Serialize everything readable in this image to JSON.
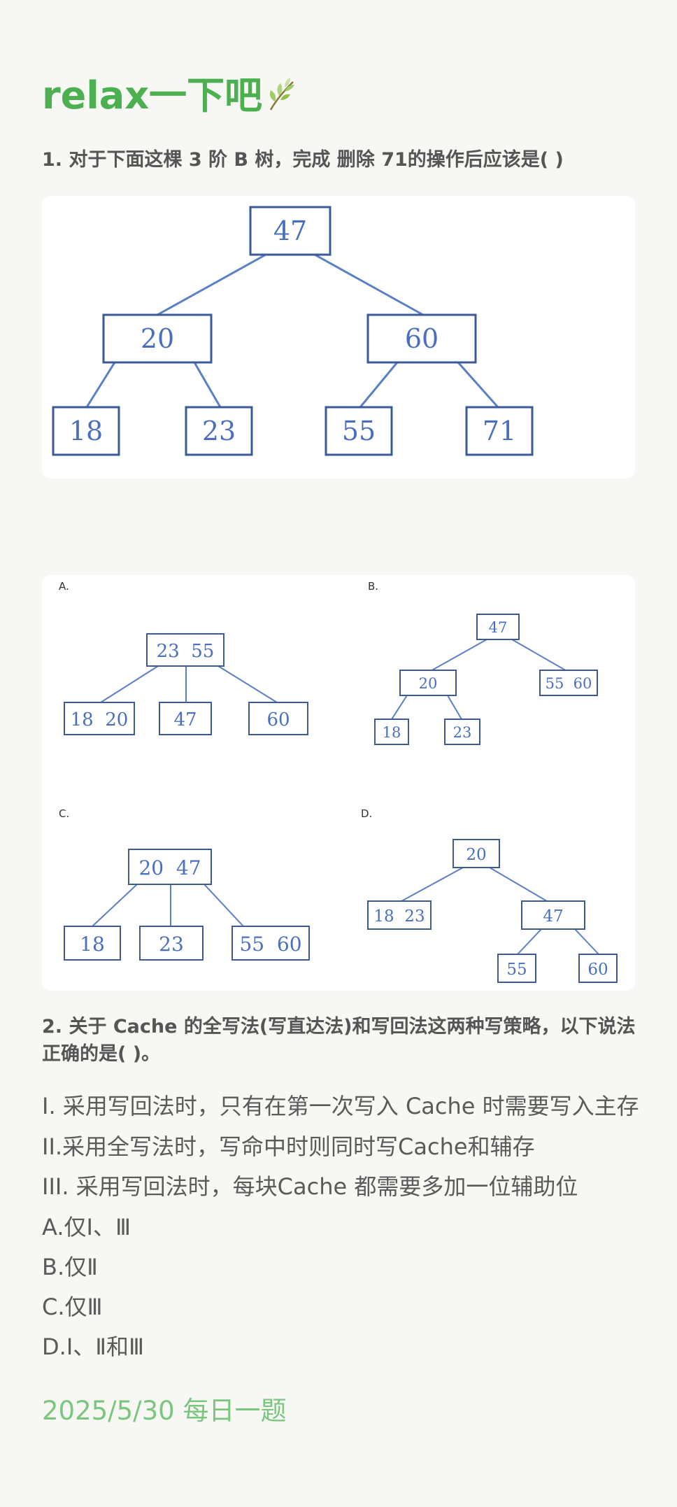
{
  "title": "relax一下吧",
  "title_icon": "leaf-icon",
  "q1": {
    "text": "1. 对于下面这棵 3 阶 B 树，完成 删除 71的操作后应该是( )",
    "tree": {
      "root": "47",
      "level2": [
        "20",
        "60"
      ],
      "leaves": [
        "18",
        "23",
        "55",
        "71"
      ]
    }
  },
  "options": {
    "A": {
      "label": "A.",
      "root": "23  55",
      "children": [
        "18  20",
        "47",
        "60"
      ]
    },
    "B": {
      "label": "B.",
      "root": "47",
      "mid_left": "20",
      "mid_right": "55  60",
      "leaves": [
        "18",
        "23"
      ]
    },
    "C": {
      "label": "C.",
      "root": "20  47",
      "children": [
        "18",
        "23",
        "55  60"
      ]
    },
    "D": {
      "label": "D.",
      "root": "20",
      "mid_left": "18  23",
      "mid_right": "47",
      "leaves": [
        "55",
        "60"
      ]
    }
  },
  "q2": {
    "text": "2. 关于 Cache 的全写法(写直达法)和写回法这两种写策略，以下说法正确的是( )。",
    "statements": [
      "I. 采用写回法时，只有在第一次写入 Cache 时需要写入主存",
      "II.采用全写法时，写命中时则同时写Cache和辅存",
      "III. 采用写回法时，每块Cache 都需要多加一位辅助位",
      "A.仅Ⅰ、Ⅲ",
      "B.仅Ⅱ",
      "C.仅Ⅲ",
      "D.Ⅰ、Ⅱ和Ⅲ"
    ]
  },
  "footer": {
    "date": "2025/5/30 每日一题"
  },
  "colors": {
    "title": "#4caf50",
    "date": "#7bc67e",
    "node_border": "#3b5a97",
    "edge": "#5b7fc6"
  }
}
